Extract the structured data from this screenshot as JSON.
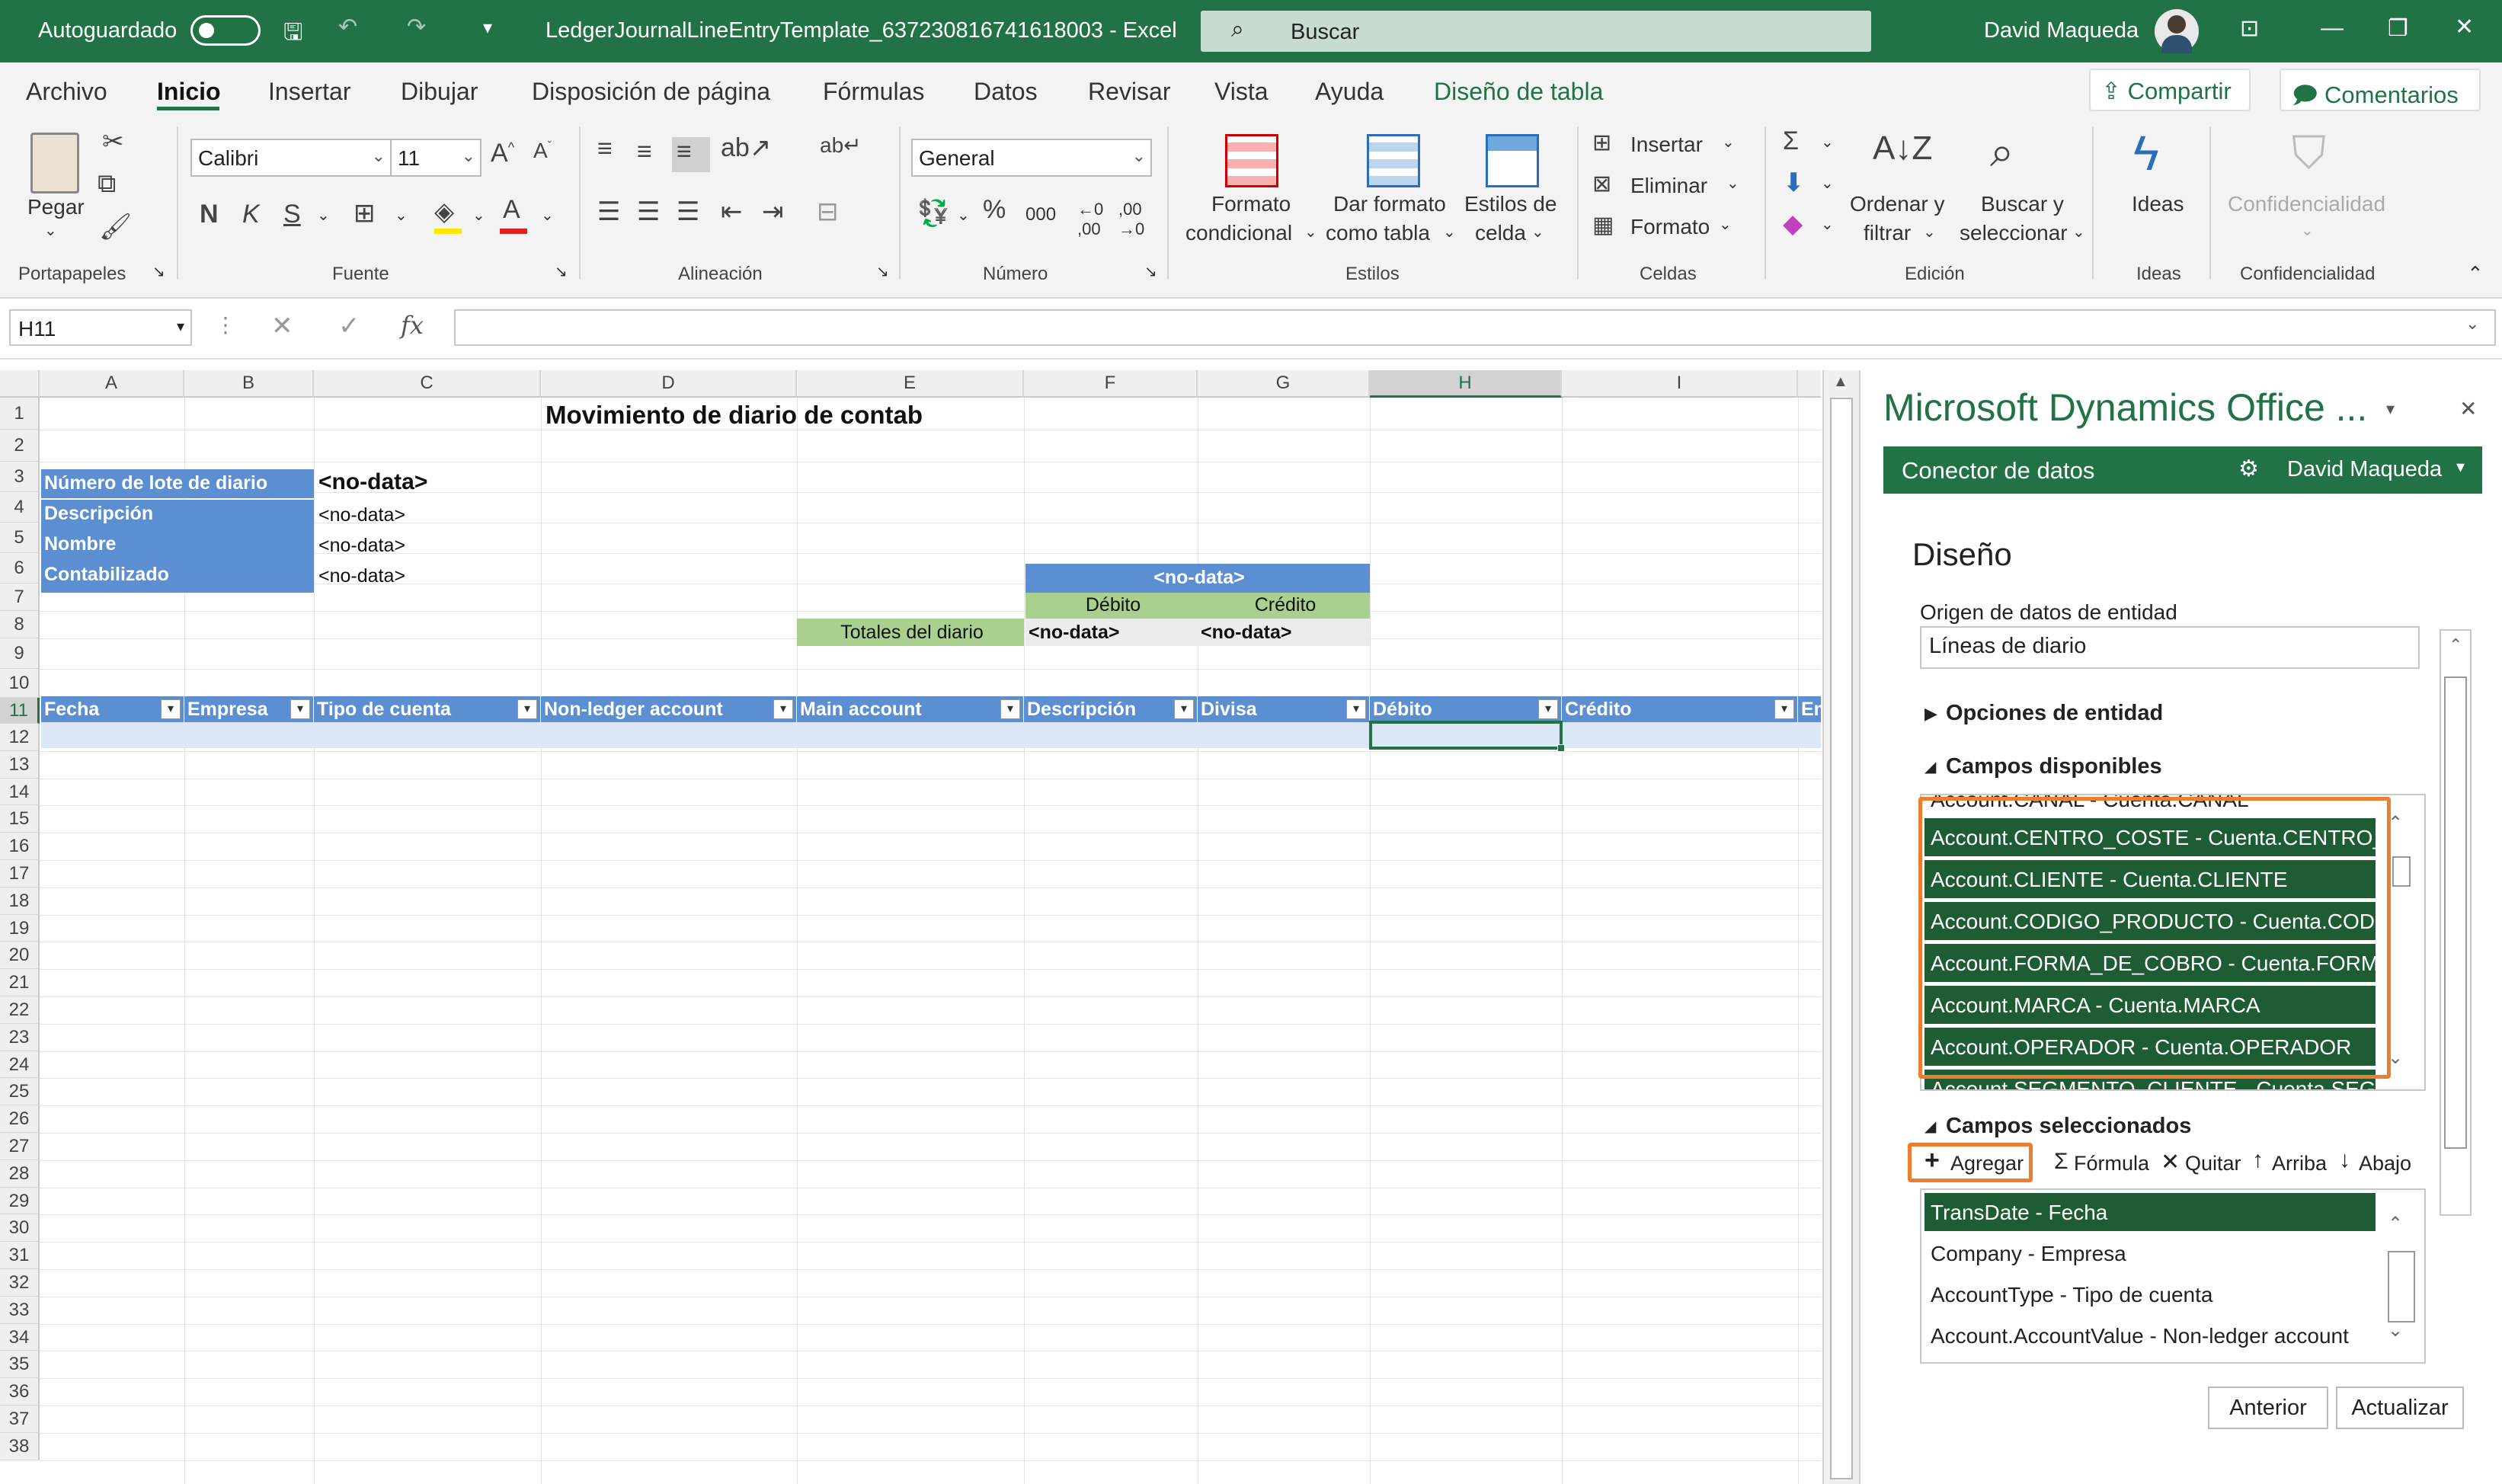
{
  "titlebar": {
    "autosave_label": "Autoguardado",
    "doc_title": "LedgerJournalLineEntryTemplate_637230816741618003  -  Excel",
    "search_placeholder": "Buscar",
    "user_name": "David Maqueda"
  },
  "menu": {
    "items": [
      "Archivo",
      "Inicio",
      "Insertar",
      "Dibujar",
      "Disposición de página",
      "Fórmulas",
      "Datos",
      "Revisar",
      "Vista",
      "Ayuda",
      "Diseño de tabla"
    ],
    "share_label": "Compartir",
    "comments_label": "Comentarios"
  },
  "ribbon": {
    "paste_label": "Pegar",
    "font_name": "Calibri",
    "font_size": "11",
    "bold": "N",
    "italic": "K",
    "underline": "S",
    "number_format": "General",
    "percent": "%",
    "thousands": "000",
    "cond_format_1": "Formato",
    "cond_format_2": "condicional",
    "table_format_1": "Dar formato",
    "table_format_2": "como tabla",
    "cell_styles_1": "Estilos de",
    "cell_styles_2": "celda",
    "insert": "Insertar",
    "delete": "Eliminar",
    "format": "Formato",
    "sort_1": "Ordenar y",
    "sort_2": "filtrar",
    "find_1": "Buscar y",
    "find_2": "seleccionar",
    "ideas": "Ideas",
    "confidentiality": "Confidencialidad",
    "groups": {
      "clipboard": "Portapapeles",
      "font": "Fuente",
      "alignment": "Alineación",
      "number": "Número",
      "styles": "Estilos",
      "cells": "Celdas",
      "editing": "Edición",
      "ideas": "Ideas",
      "confidentiality": "Confidencialidad"
    }
  },
  "formula_bar": {
    "name_box": "H11",
    "fx": "fx",
    "value": ""
  },
  "sheet": {
    "columns": [
      "A",
      "B",
      "C",
      "D",
      "E",
      "F",
      "G",
      "H",
      "I"
    ],
    "rows": [
      "1",
      "2",
      "3",
      "4",
      "5",
      "6",
      "7",
      "8",
      "9",
      "10",
      "11",
      "12",
      "13",
      "14",
      "15",
      "16",
      "17",
      "18",
      "19",
      "20",
      "21",
      "22",
      "23",
      "24",
      "25",
      "26",
      "27",
      "28",
      "29",
      "30",
      "31",
      "32",
      "33",
      "34",
      "35",
      "36",
      "37",
      "38"
    ],
    "title": "Movimiento de diario de contabilidad general",
    "labels": {
      "batch": "Número de lote de diario",
      "description": "Descripción",
      "name": "Nombre",
      "posted": "Contabilizado"
    },
    "values": {
      "batch": "<no-data>",
      "description": "<no-data>",
      "name": "<no-data>",
      "posted": "<no-data>"
    },
    "totals_header": "<no-data>",
    "debit_label": "Débito",
    "credit_label": "Crédito",
    "totals_label": "Totales del diario",
    "total_debit": "<no-data>",
    "total_credit": "<no-data>",
    "table_headers": [
      "Fecha",
      "Empresa",
      "Tipo de cuenta",
      "Non-ledger account",
      "Main account",
      "Descripción",
      "Divisa",
      "Débito",
      "Crédito",
      "Em"
    ]
  },
  "pane": {
    "title": "Microsoft Dynamics Office ...",
    "connector": "Conector de datos",
    "user": "David Maqueda",
    "design": "Diseño",
    "entity_source_label": "Origen de datos de entidad",
    "entity_source_value": "Líneas de diario",
    "entity_options": "Opciones de entidad",
    "available_fields": "Campos disponibles",
    "available_items": [
      "Account.CANAL - Cuenta.CANAL",
      "Account.CENTRO_COSTE - Cuenta.CENTRO_COSTE",
      "Account.CLIENTE - Cuenta.CLIENTE",
      "Account.CODIGO_PRODUCTO - Cuenta.CODIGO_PRODUCTO",
      "Account.FORMA_DE_COBRO - Cuenta.FORMA_DE_COBRO",
      "Account.MARCA - Cuenta.MARCA",
      "Account.OPERADOR - Cuenta.OPERADOR",
      "Account.SEGMENTO_CLIENTE - Cuenta.SEGMENTO_CLIENTE"
    ],
    "selected_fields": "Campos seleccionados",
    "toolbar": {
      "add": "Agregar",
      "formula": "Fórmula",
      "remove": "Quitar",
      "up": "Arriba",
      "down": "Abajo"
    },
    "selected_items": [
      "TransDate - Fecha",
      "Company - Empresa",
      "AccountType - Tipo de cuenta",
      "Account.AccountValue - Non-ledger account"
    ],
    "prev_button": "Anterior",
    "update_button": "Actualizar"
  },
  "colors": {
    "excel_green": "#217346",
    "table_blue": "#5b8fd1",
    "highlight_orange": "#ed7d31",
    "selected_dark_green": "#1e5c33"
  }
}
